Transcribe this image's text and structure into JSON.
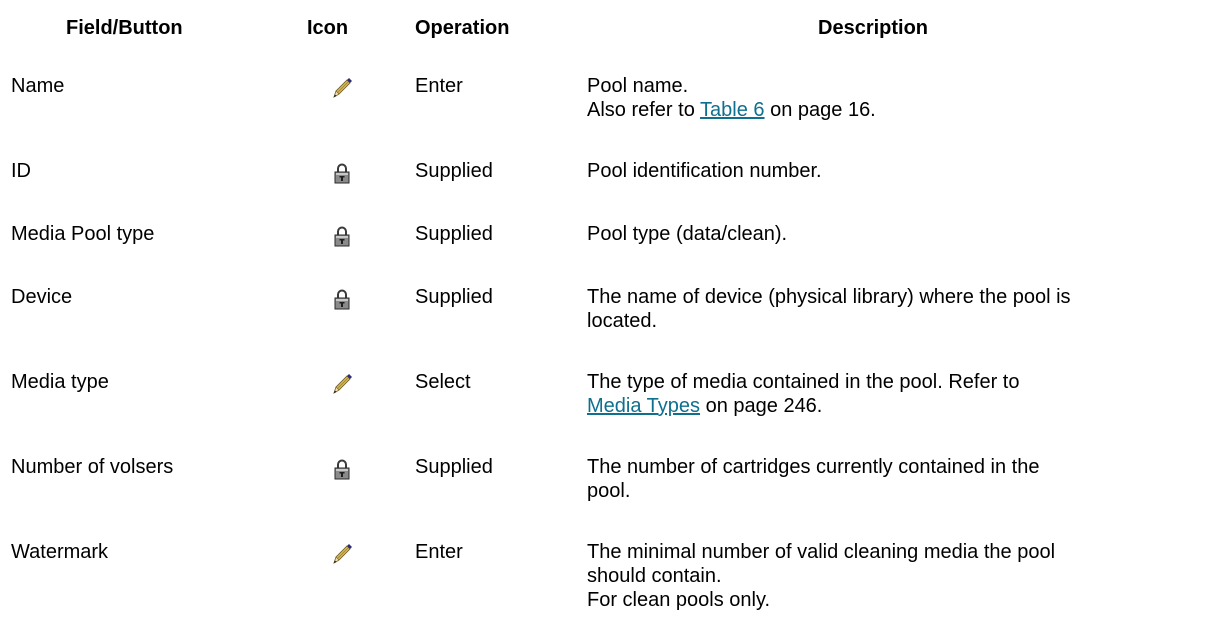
{
  "header": {
    "field": "Field/Button",
    "icon": "Icon",
    "operation": "Operation",
    "description": "Description"
  },
  "rows": [
    {
      "field": "Name",
      "icon": "pencil-icon",
      "operation": "Enter",
      "desc_line1": "Pool name.",
      "desc_line2_pre": "Also refer to ",
      "desc_line2_link": "Table 6",
      "desc_line2_post": " on page 16."
    },
    {
      "field": "ID",
      "icon": "lock-icon",
      "operation": "Supplied",
      "desc_line1": "Pool identification number."
    },
    {
      "field": "Media Pool type",
      "icon": "lock-icon",
      "operation": "Supplied",
      "desc_line1": "Pool type (data/clean)."
    },
    {
      "field": "Device",
      "icon": "lock-icon",
      "operation": "Supplied",
      "desc_line1": "The name of device (physical library) where the pool is",
      "desc_line2": "located."
    },
    {
      "field": "Media type",
      "icon": "pencil-icon",
      "operation": "Select",
      "desc_line1": "The type of media contained in the pool. Refer to",
      "desc_line2_link": "Media Types",
      "desc_line2_post": " on page 246."
    },
    {
      "field": "Number of volsers",
      "icon": "lock-icon",
      "operation": "Supplied",
      "desc_line1": "The number of cartridges currently contained in the",
      "desc_line2": "pool."
    },
    {
      "field": "Watermark",
      "icon": "pencil-icon",
      "operation": "Enter",
      "desc_line1": "The minimal number of valid cleaning media the pool",
      "desc_line2": "should contain.",
      "desc_line3": "For clean pools only."
    }
  ],
  "colors": {
    "link": "#0f6f8f",
    "text": "#000000"
  }
}
